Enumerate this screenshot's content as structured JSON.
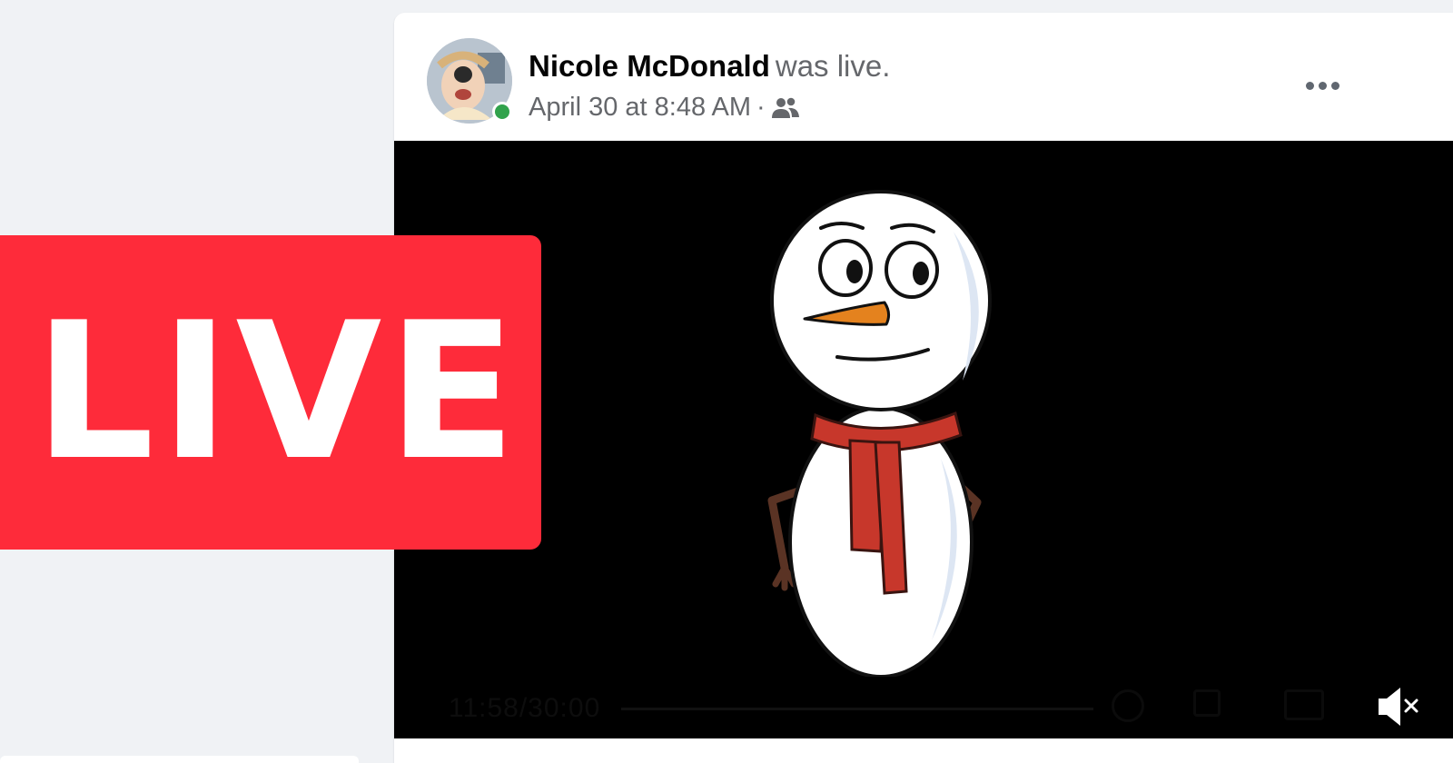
{
  "post": {
    "author_name": "Nicole McDonald",
    "action_text": "was live.",
    "timestamp": "April 30 at 8:48 AM",
    "meta_separator": "·",
    "privacy_icon": "friends-icon",
    "more_icon": "more-options-icon",
    "online_status": "online"
  },
  "video": {
    "time_readout": "11:58/30:00",
    "mute_icon": "muted-speaker-icon"
  },
  "badge": {
    "text": "LIVE"
  },
  "colors": {
    "live_red": "#fe2b3a",
    "online_green": "#31a24c",
    "name_text": "#050505",
    "secondary_text": "#65676b",
    "page_background": "#f0f2f5",
    "scarf_red": "#c7372b",
    "nose_orange": "#e4821e"
  }
}
